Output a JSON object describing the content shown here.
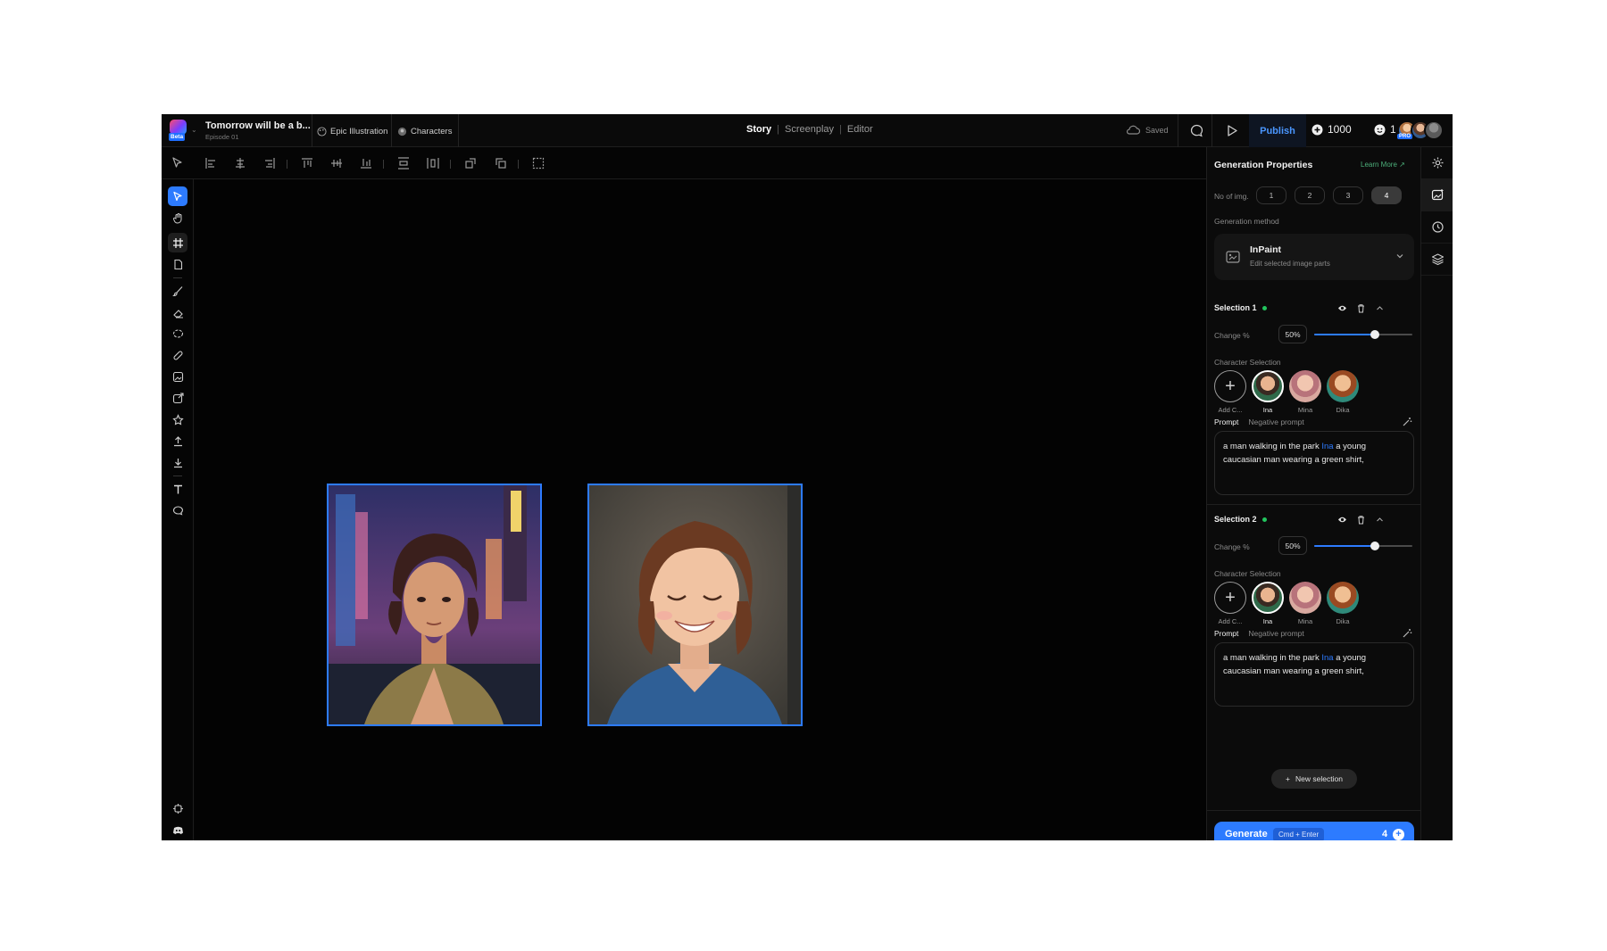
{
  "header": {
    "badge": "Beta",
    "project_title": "Tomorrow will be a b...",
    "project_episode": "Episode 01",
    "style_chip": "Epic Illustration",
    "characters_chip": "Characters",
    "modes": [
      "Story",
      "Screenplay",
      "Editor"
    ],
    "active_mode": "Story",
    "save_status": "Saved",
    "publish_label": "Publish",
    "credits": "1000",
    "users_online": "1",
    "pro_badge": "PRO"
  },
  "panel": {
    "title": "Generation Properties",
    "learn_more": "Learn More ↗",
    "no_of_img_label": "No of img.",
    "img_options": [
      "1",
      "2",
      "3",
      "4"
    ],
    "img_selected": "4",
    "method_label": "Generation method",
    "method_name": "InPaint",
    "method_desc": "Edit selected image parts",
    "selections": [
      {
        "title": "Selection 1",
        "change_label": "Change %",
        "change_value": "50%",
        "slider_fraction": 0.62,
        "char_label": "Character Selection",
        "characters": [
          {
            "name": "Add C...",
            "type": "add"
          },
          {
            "name": "Ina",
            "type": "selected"
          },
          {
            "name": "Mina",
            "type": "normal"
          },
          {
            "name": "Dika",
            "type": "normal"
          }
        ],
        "tab_prompt": "Prompt",
        "tab_negative": "Negative prompt",
        "prompt_before": "a man walking in the park ",
        "prompt_mention": "Ina",
        "prompt_after": " a young caucasian man wearing a green shirt,"
      },
      {
        "title": "Selection 2",
        "change_label": "Change %",
        "change_value": "50%",
        "slider_fraction": 0.62,
        "char_label": "Character Selection",
        "characters": [
          {
            "name": "Add C...",
            "type": "add"
          },
          {
            "name": "Ina",
            "type": "selected"
          },
          {
            "name": "Mina",
            "type": "normal"
          },
          {
            "name": "Dika",
            "type": "normal"
          }
        ],
        "tab_prompt": "Prompt",
        "tab_negative": "Negative prompt",
        "prompt_before": "a man walking in the park ",
        "prompt_mention": "Ina",
        "prompt_after": " a young caucasian man wearing a green shirt,"
      }
    ],
    "new_selection": "New selection",
    "generate_label": "Generate",
    "generate_shortcut": "Cmd + Enter",
    "generate_count": "4"
  },
  "colors": {
    "accent": "#2d7bff",
    "status_green": "#22c55e",
    "learn_more": "#4caf7a"
  },
  "icons": {
    "toolbar": [
      "pointer-icon",
      "align-left-icon",
      "align-center-h-icon",
      "align-right-icon",
      "align-top-icon",
      "align-middle-v-icon",
      "align-bottom-icon",
      "distribute-v-icon",
      "distribute-h-icon",
      "bring-forward-icon",
      "send-backward-icon",
      "select-area-icon"
    ],
    "rail": [
      "select-icon",
      "hand-icon",
      "grid-crop-icon",
      "page-icon",
      "brush-icon",
      "eraser-icon",
      "lasso-icon",
      "healing-icon",
      "image-edit-icon",
      "image-export-icon",
      "magic-shape-icon",
      "upload-icon",
      "download-icon",
      "text-icon",
      "comment-icon",
      "settings-gear-icon",
      "discord-icon"
    ],
    "panel_rail": [
      "settings-icon",
      "image-generate-icon",
      "history-icon",
      "layers-icon"
    ]
  }
}
